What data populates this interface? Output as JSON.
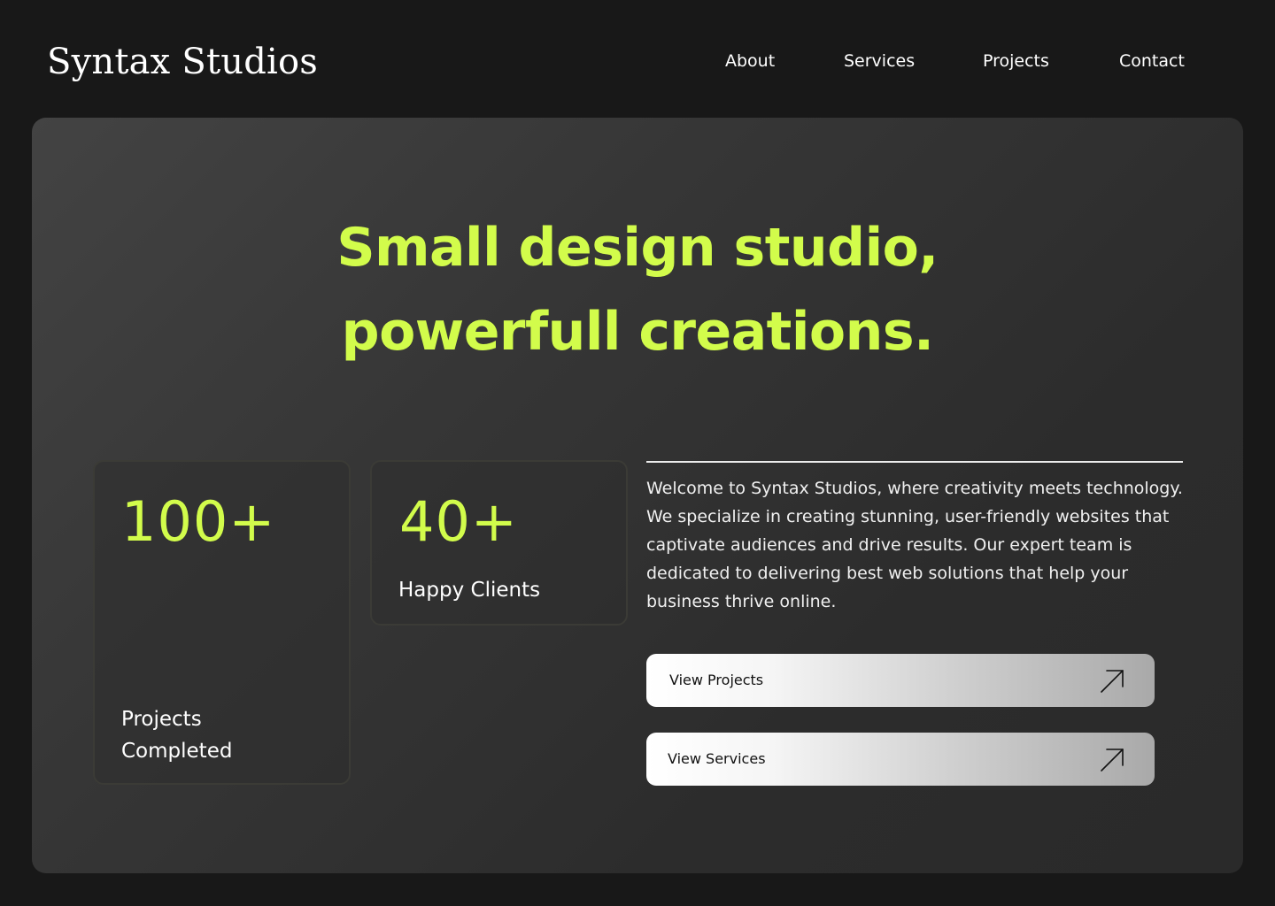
{
  "header": {
    "logo": "Syntax Studios",
    "nav": [
      "About",
      "Services",
      "Projects",
      "Contact"
    ]
  },
  "hero": {
    "headline_line1": "Small design studio,",
    "headline_line2": "powerfull creations.",
    "accent_color": "#d2fc4b",
    "stats": [
      {
        "value": "100+",
        "label": "Projects Completed"
      },
      {
        "value": "40+",
        "label": "Happy Clients"
      }
    ],
    "intro": "Welcome to Syntax Studios, where creativity meets technology. We specialize in creating stunning, user-friendly websites that captivate audiences and drive results. Our expert team is dedicated to delivering best web solutions that help your business thrive online.",
    "buttons": [
      {
        "label": "View Projects",
        "icon": "arrow-up-right-icon"
      },
      {
        "label": "View Services",
        "icon": "arrow-up-right-icon"
      }
    ]
  }
}
